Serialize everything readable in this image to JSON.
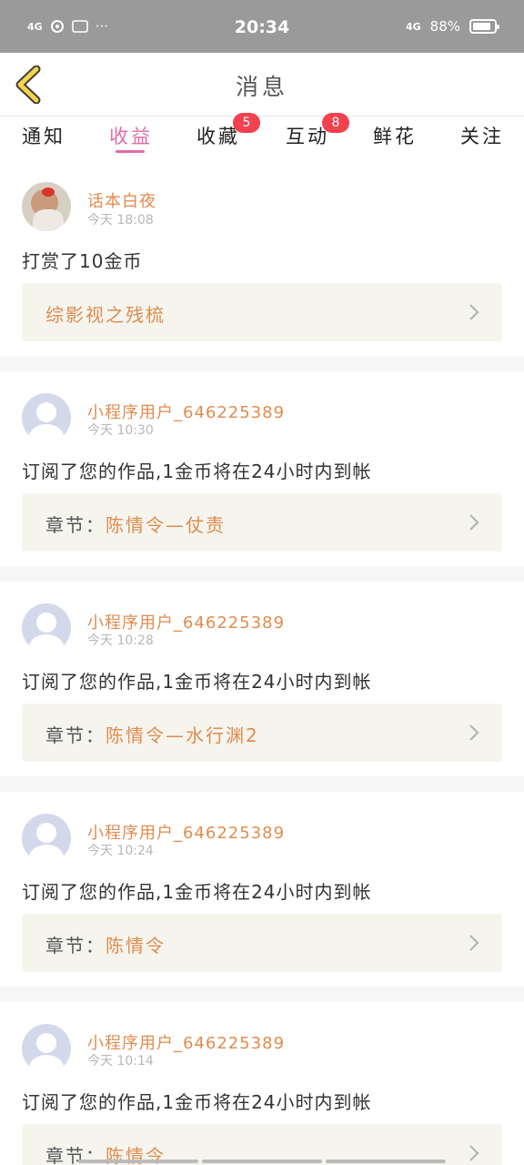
{
  "status_bar": {
    "left_icons": [
      "4G signal",
      "hotspot",
      "iqiyi",
      "more"
    ],
    "left_sig": "4G",
    "left_extra": "···",
    "time": "20:34",
    "network": "4G",
    "battery": "88%",
    "battery_level": 0.88
  },
  "header": {
    "title": "消息",
    "back_icon": "chevron-left-icon"
  },
  "tabs": [
    {
      "label": "通知",
      "badge": ""
    },
    {
      "label": "收益",
      "badge": "",
      "active": true
    },
    {
      "label": "收藏",
      "badge": "5"
    },
    {
      "label": "互动",
      "badge": "8"
    },
    {
      "label": "鲜花",
      "badge": ""
    },
    {
      "label": "关注",
      "badge": ""
    }
  ],
  "messages": [
    {
      "user": "话本白夜",
      "time": "今天 18:08",
      "text": "打赏了10金币",
      "link_label": "",
      "link_value": "综影视之残梳"
    },
    {
      "user": "小程序用户_646225389",
      "time": "今天 10:30",
      "text": "订阅了您的作品,1金币将在24小时内到帐",
      "link_label": "章节：",
      "link_value": "陈情令—仗责"
    },
    {
      "user": "小程序用户_646225389",
      "time": "今天 10:28",
      "text": "订阅了您的作品,1金币将在24小时内到帐",
      "link_label": "章节：",
      "link_value": "陈情令—水行渊2"
    },
    {
      "user": "小程序用户_646225389",
      "time": "今天 10:24",
      "text": "订阅了您的作品,1金币将在24小时内到帐",
      "link_label": "章节：",
      "link_value": "陈情令"
    },
    {
      "user": "小程序用户_646225389",
      "time": "今天 10:14",
      "text": "订阅了您的作品,1金币将在24小时内到帐",
      "link_label": "章节：",
      "link_value": "陈情令"
    }
  ],
  "colors": {
    "accent_pink": "#e46aa6",
    "name_orange": "#e08c4f",
    "badge_red": "#f2414f",
    "back_yellow": "#f4d24a"
  }
}
